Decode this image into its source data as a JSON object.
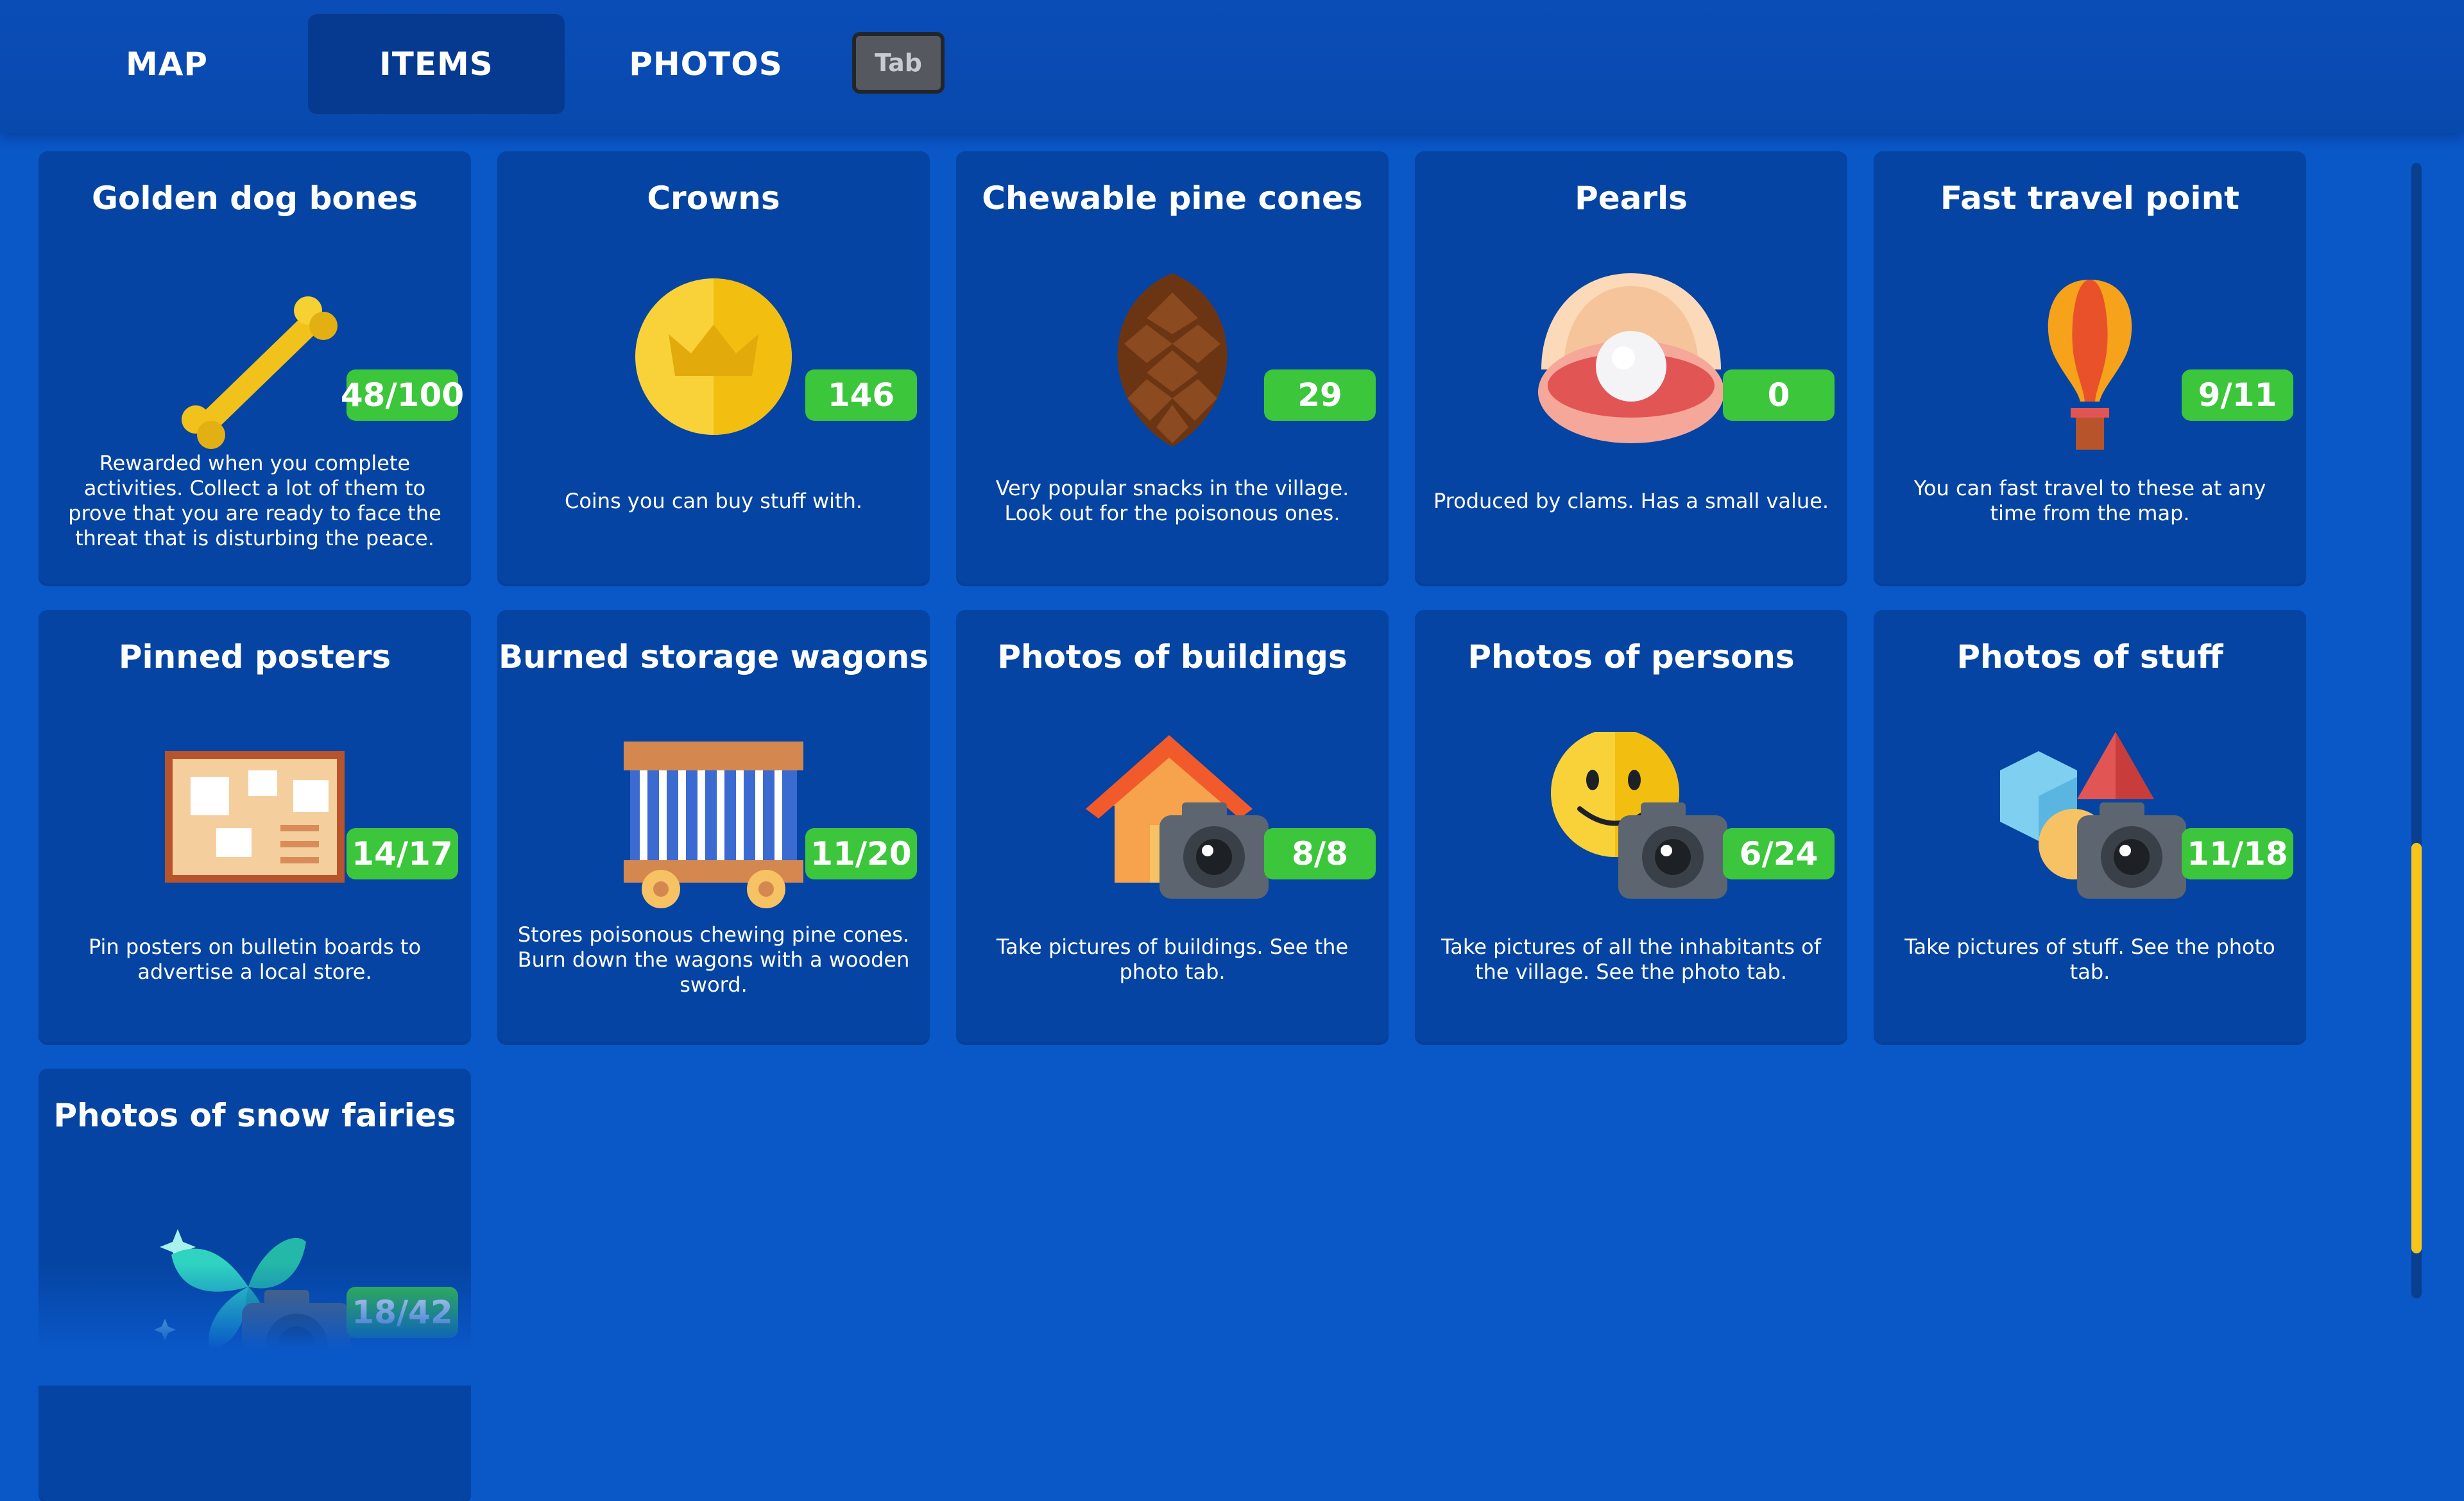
{
  "tabs": [
    {
      "label": "MAP",
      "active": false
    },
    {
      "label": "ITEMS",
      "active": true
    },
    {
      "label": "PHOTOS",
      "active": false
    }
  ],
  "tab_key_hint": "Tab",
  "items": [
    {
      "title": "Golden dog bones",
      "count": "48/100",
      "icon": "bone-icon",
      "description": "Rewarded when you complete activities. Collect a lot of them to prove that you are ready to face the threat that is disturbing the peace."
    },
    {
      "title": "Crowns",
      "count": "146",
      "icon": "crown-coin-icon",
      "description": "Coins you can buy stuff with."
    },
    {
      "title": "Chewable pine cones",
      "count": "29",
      "icon": "pine-cone-icon",
      "description": "Very popular snacks in the village. Look out for the poisonous ones."
    },
    {
      "title": "Pearls",
      "count": "0",
      "icon": "pearl-clam-icon",
      "description": "Produced by clams. Has a small value."
    },
    {
      "title": "Fast travel point",
      "count": "9/11",
      "icon": "hot-air-balloon-icon",
      "description": "You can fast travel to these at any time from the map."
    },
    {
      "title": "Pinned posters",
      "count": "14/17",
      "icon": "bulletin-board-icon",
      "description": "Pin posters on bulletin boards to advertise a local store."
    },
    {
      "title": "Burned storage wagons",
      "count": "11/20",
      "icon": "wagon-icon",
      "description": "Stores poisonous chewing pine cones. Burn down the wagons with a wooden sword."
    },
    {
      "title": "Photos of buildings",
      "count": "8/8",
      "icon": "house-camera-icon",
      "description": "Take pictures of buildings. See the photo tab."
    },
    {
      "title": "Photos of persons",
      "count": "6/24",
      "icon": "smiley-camera-icon",
      "description": "Take pictures of all the inhabitants of the village. See the photo tab."
    },
    {
      "title": "Photos of stuff",
      "count": "11/18",
      "icon": "shapes-camera-icon",
      "description": "Take pictures of stuff. See the photo tab."
    },
    {
      "title": "Photos of snow fairies",
      "count": "18/42",
      "icon": "fairy-camera-icon",
      "description": ""
    }
  ],
  "colors": {
    "background": "#0a57c8",
    "card": "#0544a2",
    "badge": "#3cc63b",
    "active_tab": "#063a90",
    "scroll_thumb": "#f7c51a"
  }
}
